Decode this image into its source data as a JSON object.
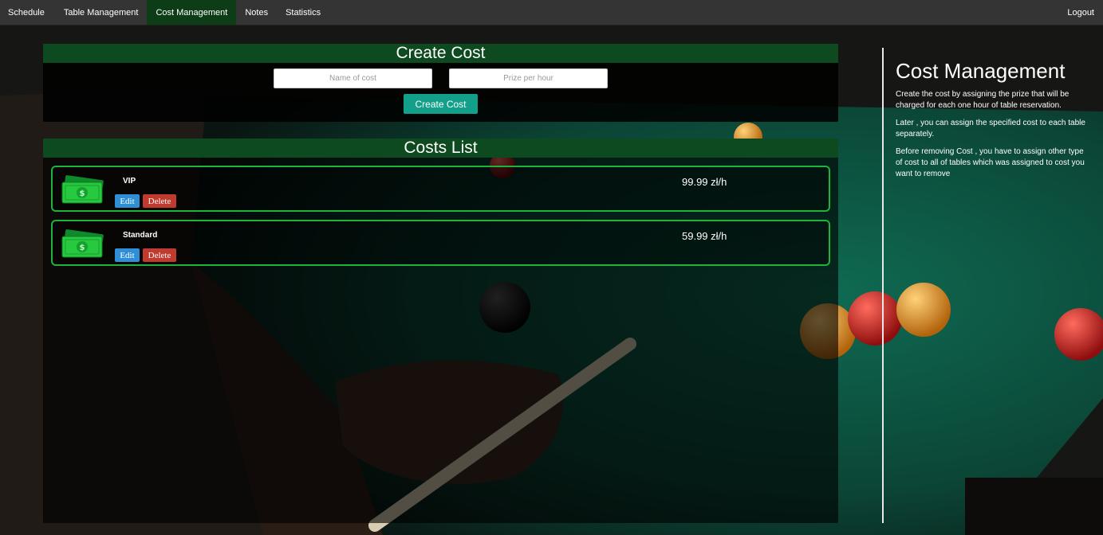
{
  "nav": {
    "items": [
      {
        "label": "Schedule"
      },
      {
        "label": "Table Management"
      },
      {
        "label": "Cost Management",
        "active": true
      },
      {
        "label": "Notes"
      },
      {
        "label": "Statistics"
      }
    ],
    "logout": "Logout"
  },
  "create": {
    "title": "Create Cost",
    "name_placeholder": "Name of cost",
    "price_placeholder": "Prize per hour",
    "submit_label": "Create Cost"
  },
  "list": {
    "title": "Costs List",
    "items": [
      {
        "name": "VIP",
        "price": "99.99 zł/h",
        "edit_label": "Edit",
        "delete_label": "Delete"
      },
      {
        "name": "Standard",
        "price": "59.99 zł/h",
        "edit_label": "Edit",
        "delete_label": "Delete"
      }
    ]
  },
  "info": {
    "title": "Cost Management",
    "paragraphs": [
      "Create the cost by assigning the prize that will be charged for each one hour of table reservation.",
      "Later , you can assign the specified cost to each table separately.",
      "Before removing Cost , you have to assign other type of cost to all of tables which was assigned to cost you want to remove"
    ]
  },
  "colors": {
    "nav_bg": "#343434",
    "nav_active": "#0d3d17",
    "panel_header": "#0e4a1f",
    "card_border": "#1db33d",
    "create_button": "#12a08a",
    "edit_button": "#2f8fd6",
    "delete_button": "#c03a2e"
  },
  "icons": {
    "cost_icon": "money-bills-icon",
    "background": "billiard-table-photo"
  }
}
